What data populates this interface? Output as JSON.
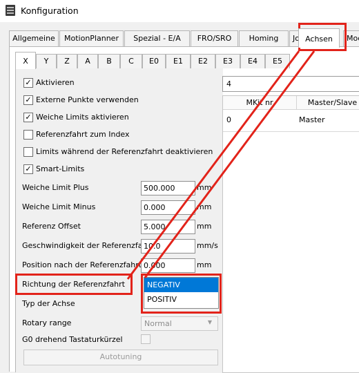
{
  "window": {
    "title": "Konfiguration",
    "icon": "app-logo-icon"
  },
  "main_tabs": [
    "Allgemeine",
    "MotionPlanner",
    "Spezial - E/A",
    "FRO/SRO",
    "Homing",
    "Jog",
    "Achsen",
    "Mod"
  ],
  "main_tabs_active": "Achsen",
  "axis_tabs": [
    "X",
    "Y",
    "Z",
    "A",
    "B",
    "C",
    "E0",
    "E1",
    "E2",
    "E3",
    "E4",
    "E5"
  ],
  "axis_tabs_active": "X",
  "checkboxes": [
    {
      "label": "Aktivieren",
      "checked": true,
      "mark": "✓"
    },
    {
      "label": "Externe Punkte verwenden",
      "checked": true,
      "mark": "✓"
    },
    {
      "label": "Weiche Limits aktivieren",
      "checked": true,
      "mark": "✓"
    },
    {
      "label": "Referenzfahrt zum Index",
      "checked": false,
      "mark": ""
    },
    {
      "label": "Limits während der Referenzfahrt deaktivieren",
      "checked": false,
      "mark": ""
    },
    {
      "label": "Smart-Limits",
      "checked": true,
      "mark": "✓"
    }
  ],
  "fields": [
    {
      "label": "Weiche Limit Plus",
      "value": "500.000",
      "unit": "mm"
    },
    {
      "label": "Weiche Limit Minus",
      "value": "0.000",
      "unit": "mm"
    },
    {
      "label": "Referenz Offset",
      "value": "5.000",
      "unit": "mm"
    },
    {
      "label": "Geschwindigkeit der Referenzfahrt",
      "value": "10.0",
      "unit": "mm/s"
    },
    {
      "label": "Position nach der Referenzfahrt",
      "value": "0.000",
      "unit": "mm"
    }
  ],
  "homing_direction": {
    "label": "Richtung der Referenzfahrt",
    "options": [
      "NEGATIV",
      "POSITIV"
    ],
    "highlighted": "NEGATIV"
  },
  "axis_type_label": "Typ der Achse",
  "rotary_range": {
    "label": "Rotary range",
    "value": "Normal"
  },
  "g0_shortcut_label": "G0 drehend Tastaturkürzel",
  "autotuning_label": "Autotuning",
  "right_panel": {
    "selector_value": "4",
    "table_headers": [
      "MKit nr",
      "Master/Slave"
    ],
    "rows": [
      {
        "mkit": "0",
        "role": "Master"
      }
    ]
  },
  "colors": {
    "annotation": "#e2231a",
    "selection": "#0078d7"
  }
}
